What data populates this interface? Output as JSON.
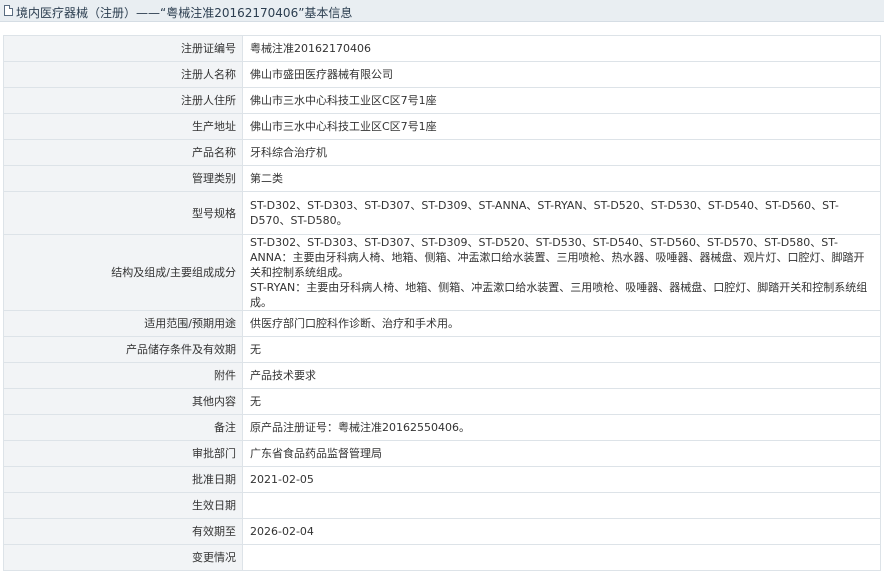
{
  "header": {
    "title": "境内医疗器械（注册）——“粤械注准20162170406”基本信息"
  },
  "rows": [
    {
      "label": "注册证编号",
      "value": "粤械注准20162170406"
    },
    {
      "label": "注册人名称",
      "value": "佛山市盛田医疗器械有限公司"
    },
    {
      "label": "注册人住所",
      "value": "佛山市三水中心科技工业区C区7号1座"
    },
    {
      "label": "生产地址",
      "value": "佛山市三水中心科技工业区C区7号1座"
    },
    {
      "label": "产品名称",
      "value": "牙科综合治疗机"
    },
    {
      "label": "管理类别",
      "value": "第二类"
    },
    {
      "label": "型号规格",
      "value": "ST-D302、ST-D303、ST-D307、ST-D309、ST-ANNA、ST-RYAN、ST-D520、ST-D530、ST-D540、ST-D560、ST-D570、ST-D580。"
    },
    {
      "label": "结构及组成/主要组成成分",
      "value": "ST-D302、ST-D303、ST-D307、ST-D309、ST-D520、ST-D530、ST-D540、ST-D560、ST-D570、ST-D580、ST-ANNA：主要由牙科病人椅、地箱、侧箱、冲盂漱口给水装置、三用喷枪、热水器、吸唾器、器械盘、观片灯、口腔灯、脚踏开关和控制系统组成。",
      "value2": "ST-RYAN：主要由牙科病人椅、地箱、侧箱、冲盂漱口给水装置、三用喷枪、吸唾器、器械盘、口腔灯、脚踏开关和控制系统组成。"
    },
    {
      "label": "适用范围/预期用途",
      "value": "供医疗部门口腔科作诊断、治疗和手术用。"
    },
    {
      "label": "产品储存条件及有效期",
      "value": "无"
    },
    {
      "label": "附件",
      "value": "产品技术要求"
    },
    {
      "label": "其他内容",
      "value": "无"
    },
    {
      "label": "备注",
      "value": "原产品注册证号：粤械注准20162550406。"
    },
    {
      "label": "审批部门",
      "value": "广东省食品药品监督管理局"
    },
    {
      "label": "批准日期",
      "value": "2021-02-05"
    },
    {
      "label": "生效日期",
      "value": ""
    },
    {
      "label": "有效期至",
      "value": "2026-02-04"
    },
    {
      "label": "变更情况",
      "value": ""
    }
  ]
}
